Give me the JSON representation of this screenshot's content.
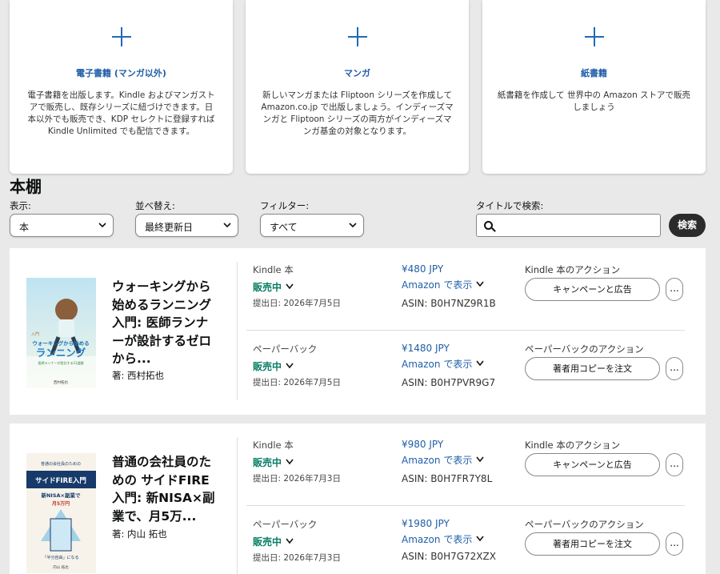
{
  "create_cards": [
    {
      "title": "電子書籍 (マンガ以外)",
      "lines": [
        "電子書籍を出版します。Kindle およびマンガスト",
        "アで販売し、既存シリーズに紐づけできます。日",
        "本以外でも販売でき、KDP セレクトに登録すれば",
        "Kindle Unlimited でも配信できます。"
      ]
    },
    {
      "title": "マンガ",
      "lines": [
        "新しいマンガまたは Fliptoon シリーズを作成して",
        "Amazon.co.jp で出版しましょう。インディーズマ",
        "ンガと Fliptoon シリーズの両方がインディーズマ",
        "ンガ基金の対象となります。"
      ]
    },
    {
      "title": "紙書籍",
      "lines": [
        "紙書籍を作成して 世界中の Amazon ストアで販売",
        "しましょう"
      ]
    }
  ],
  "shelf": {
    "title": "本棚",
    "display_label": "表示:",
    "display_value": "本",
    "sort_label": "並べ替え:",
    "sort_value": "最終更新日",
    "filter_label": "フィルター:",
    "filter_value": "すべて",
    "search_label": "タイトルで検索:",
    "search_placeholder": "",
    "search_button": "検索"
  },
  "books": [
    {
      "title_lines": [
        "ウォーキングから",
        "始めるランニング",
        "入門: 医師ランナ",
        "ーが設計するゼロ",
        "から..."
      ],
      "author": "著: 西村拓也",
      "cover": {
        "top_text": "歩くことから走ることへ",
        "title_a": "ウォーキングから始める",
        "title_b": "ランニング",
        "badge": "入門",
        "subtitle": "医師ランナーが設計する12週間",
        "author": "西村拓也"
      },
      "formats": [
        {
          "type": "Kindle 本",
          "status": "販売中",
          "submitted": "提出日: 2026年7月5日",
          "price": "¥480 JPY",
          "view": "Amazon で表示",
          "asin": "ASIN: B0H7NZ9R1B",
          "action_label": "Kindle 本のアクション",
          "action_button": "キャンペーンと広告",
          "more": "..."
        },
        {
          "type": "ペーパーバック",
          "status": "販売中",
          "submitted": "提出日: 2026年7月5日",
          "price": "¥1480 JPY",
          "view": "Amazon で表示",
          "asin": "ASIN: B0H7PVR9G7",
          "action_label": "ペーパーバックのアクション",
          "action_button": "著者用コピーを注文",
          "more": "..."
        }
      ]
    },
    {
      "title_lines": [
        "普通の会社員のた",
        "めの サイドFIRE",
        "入門: 新NISA×副",
        "業で、月5万..."
      ],
      "author": "著: 内山 拓也",
      "cover": {
        "top_text": "普通の会社員のための",
        "title_a": "サイドFIRE入門",
        "title_b": "新NISA×副業で",
        "badge": "月5万円",
        "subtitle": "「半分自由」になる",
        "author": "内山 拓也"
      },
      "formats": [
        {
          "type": "Kindle 本",
          "status": "販売中",
          "submitted": "提出日: 2026年7月3日",
          "price": "¥980 JPY",
          "view": "Amazon で表示",
          "asin": "ASIN: B0H7FR7Y8L",
          "action_label": "Kindle 本のアクション",
          "action_button": "キャンペーンと広告",
          "more": "..."
        },
        {
          "type": "ペーパーバック",
          "status": "販売中",
          "submitted": "提出日: 2026年7月3日",
          "price": "¥1980 JPY",
          "view": "Amazon で表示",
          "asin": "ASIN: B0H7G72XZX",
          "action_label": "ペーパーバックのアクション",
          "action_button": "著者用コピーを注文",
          "more": "..."
        }
      ]
    }
  ],
  "colors": {
    "accent": "#1f5ea8",
    "status": "#067d62",
    "button_dark": "#2b2b2b"
  }
}
